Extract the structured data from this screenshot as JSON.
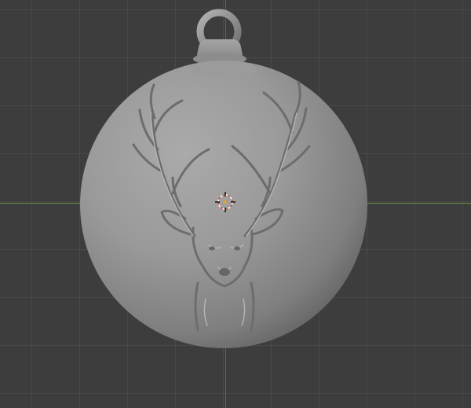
{
  "viewport": {
    "background_color": "#3d3d3d",
    "grid_color": "#4a4a4a",
    "x_axis_color": "#6f8f3a",
    "y_axis_color": "#3f6aa0"
  },
  "scene": {
    "object": "christmas-ornament-ball",
    "engraving": "deer-head-with-antlers",
    "material_color": "#8e8e8e",
    "cursor": "3d-cursor-icon"
  }
}
